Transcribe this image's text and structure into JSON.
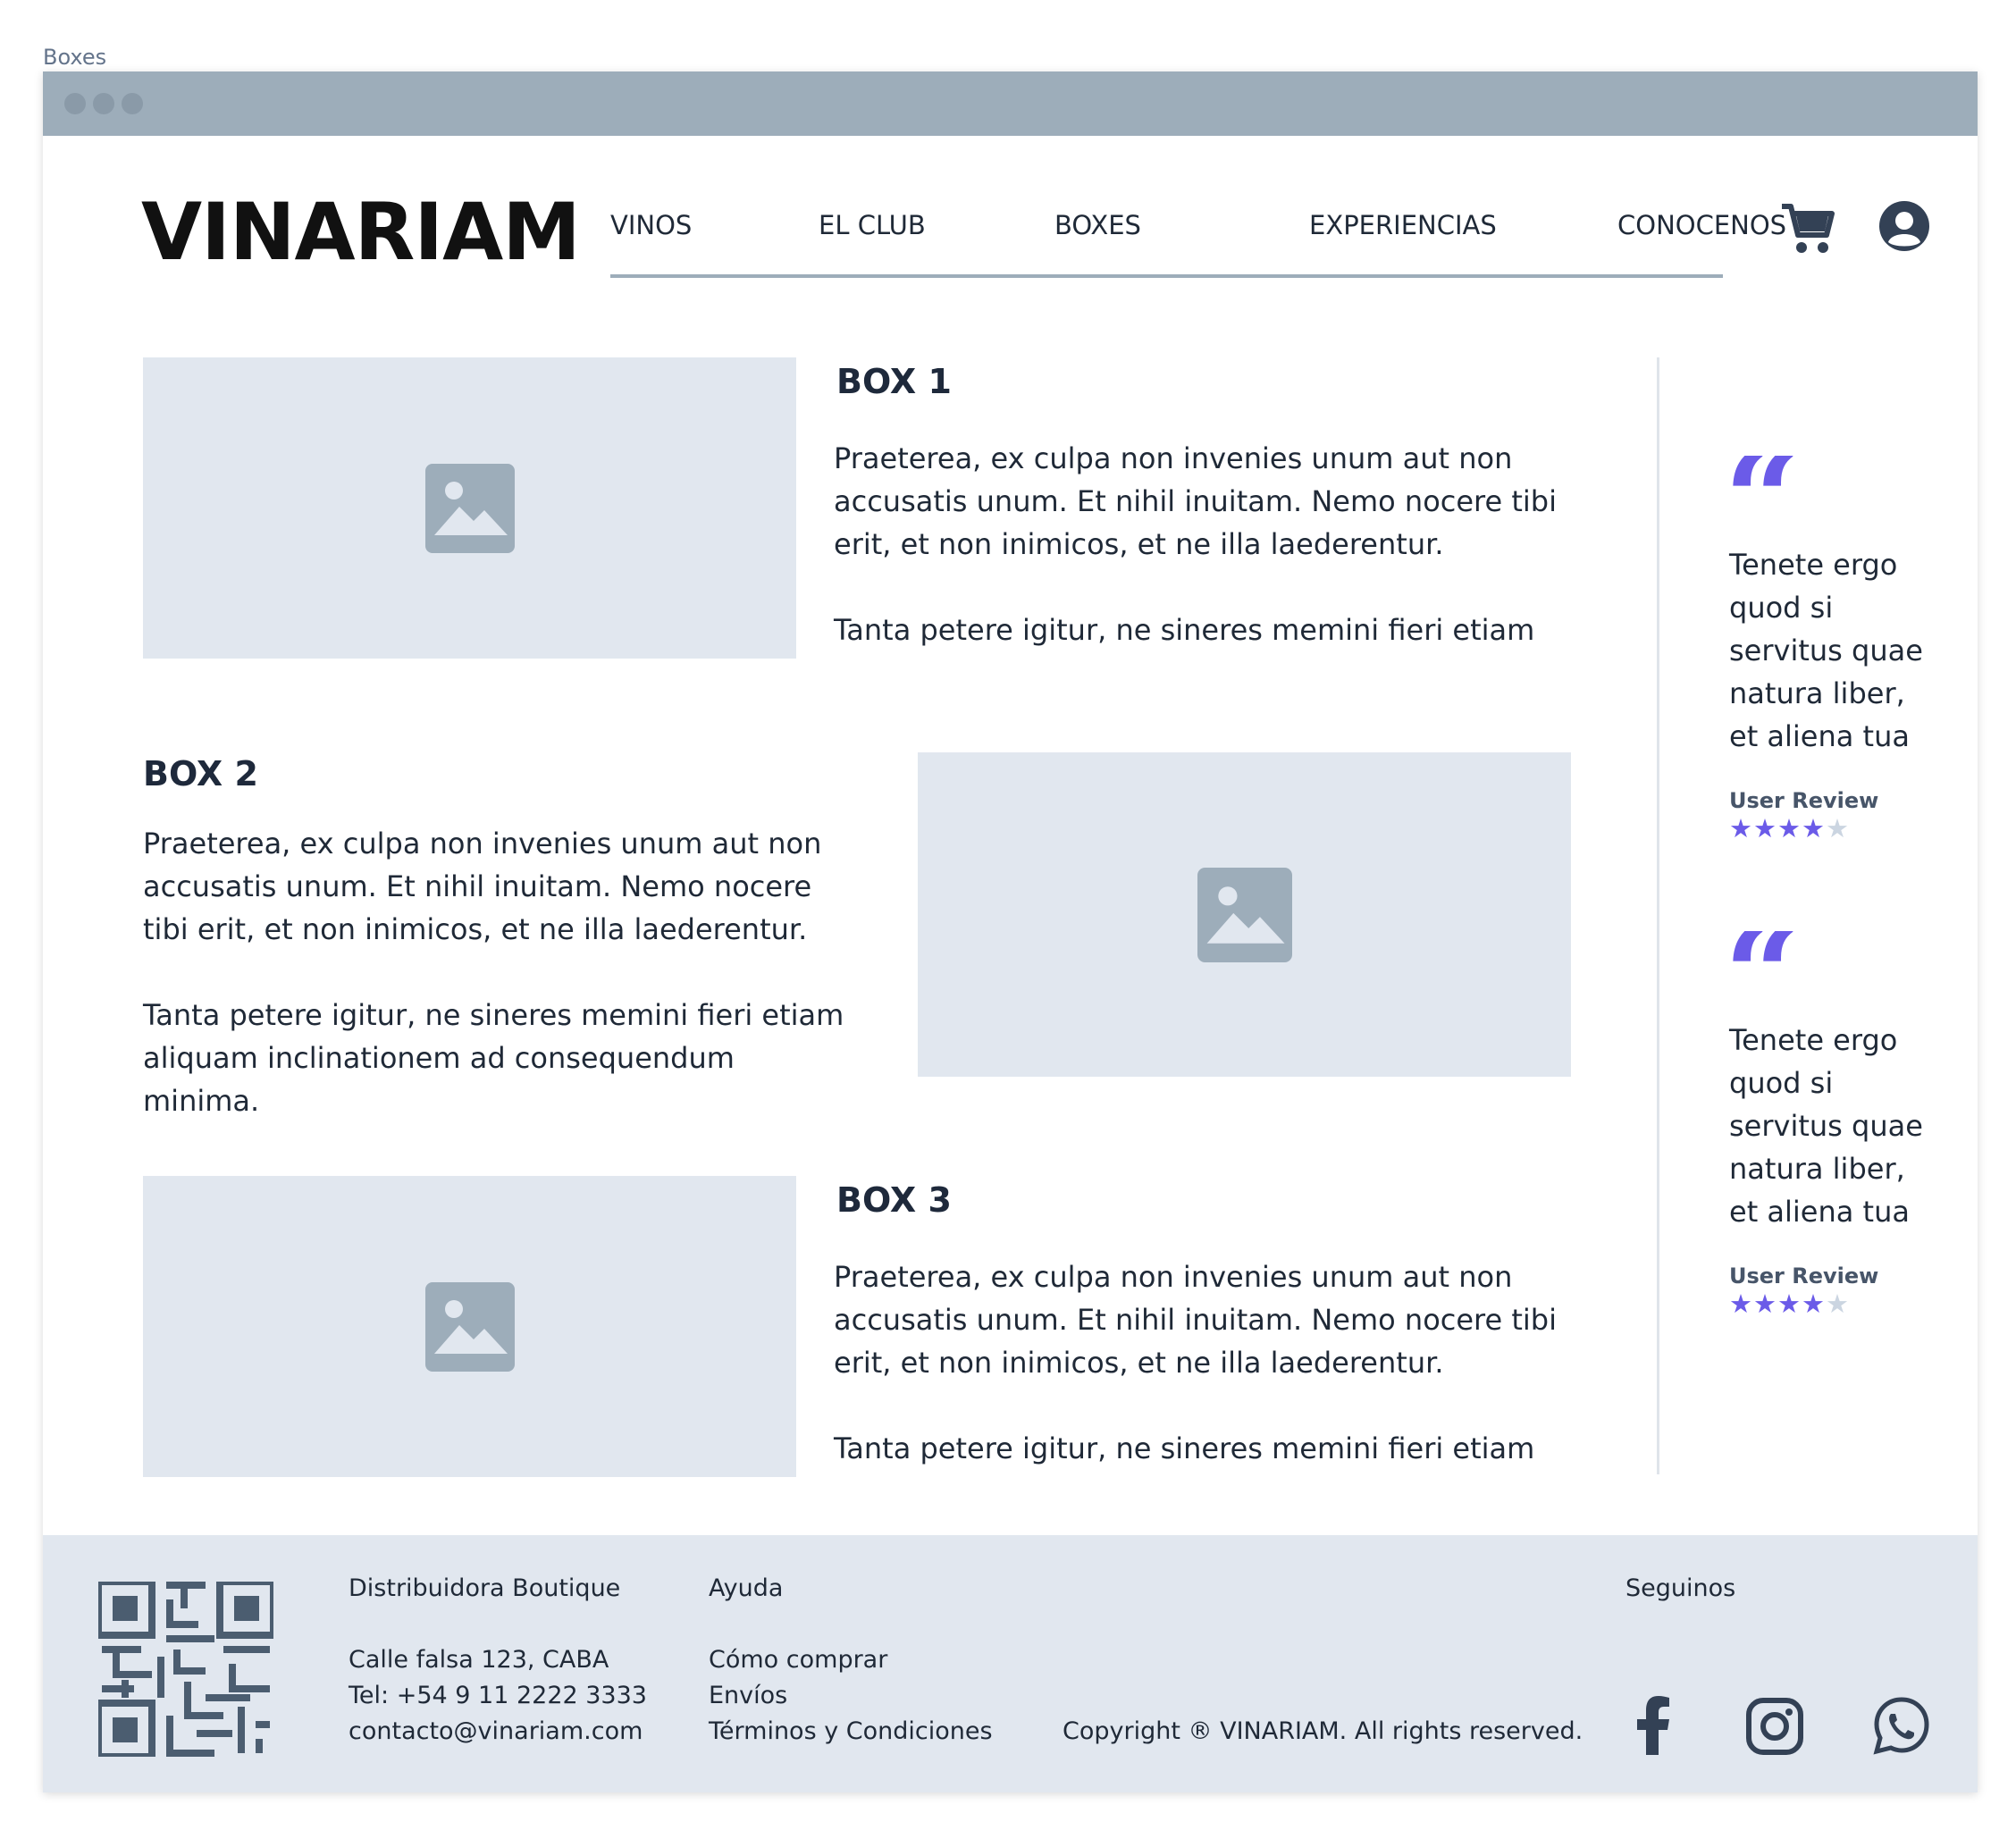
{
  "frame": {
    "label": "Boxes"
  },
  "header": {
    "logo": "VINARIAM",
    "nav": [
      "VINOS",
      "EL CLUB",
      "BOXES",
      "EXPERIENCIAS",
      "CONOCENOS"
    ],
    "icons": [
      "cart-icon",
      "user-icon"
    ]
  },
  "boxes": [
    {
      "title": "BOX 1",
      "para1": "Praeterea, ex culpa non invenies unum aut non accusatis unum. Et nihil inuitam. Nemo nocere tibi erit, et non inimicos, et ne illa laederentur.",
      "para2": "Tanta petere igitur, ne sineres memini fieri etiam"
    },
    {
      "title": "BOX 2",
      "para1": "Praeterea, ex culpa non invenies unum aut non accusatis unum. Et nihil inuitam. Nemo nocere tibi erit, et non inimicos, et ne illa laederentur.",
      "para2": "Tanta petere igitur, ne sineres memini fieri etiam aliquam inclinationem ad consequendum minima."
    },
    {
      "title": "BOX 3",
      "para1": "Praeterea, ex culpa non invenies unum aut non accusatis unum. Et nihil inuitam. Nemo nocere tibi erit, et non inimicos, et ne illa laederentur.",
      "para2": "Tanta petere igitur, ne sineres memini fieri etiam"
    }
  ],
  "reviews": [
    {
      "quote": "Tenete ergo quod si servitus quae natura liber, et aliena tua",
      "label": "User Review",
      "rating": 4,
      "max": 5
    },
    {
      "quote": "Tenete ergo quod si servitus quae natura liber, et aliena tua",
      "label": "User Review",
      "rating": 4,
      "max": 5
    }
  ],
  "footer": {
    "company": "Distribuidora Boutique",
    "address": "Calle falsa 123, CABA",
    "phone": "Tel: +54 9 11 2222 3333",
    "email": "contacto@vinariam.com",
    "help_title": "Ayuda",
    "help_links": [
      "Cómo comprar",
      "Envíos",
      "Términos y Condiciones"
    ],
    "copyright": "Copyright ® VINARIAM. All rights reserved.",
    "follow_title": "Seguinos",
    "social": [
      "facebook-icon",
      "instagram-icon",
      "whatsapp-icon"
    ]
  },
  "colors": {
    "accent": "#6b5be8",
    "titlebar": "#9dadba",
    "placeholder": "#e1e7ef",
    "footer": "#e1e7ef"
  }
}
